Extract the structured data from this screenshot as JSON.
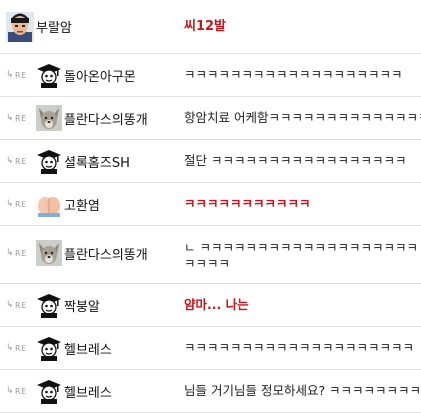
{
  "reply_marker": "RE",
  "post": {
    "author": "부랄암",
    "comment": "씨12발"
  },
  "replies": [
    {
      "author": "돌아온아구몬",
      "avatar": "graduate",
      "comment": "ㅋㅋㅋㅋㅋㅋㅋㅋㅋㅋㅋㅋㅋㅋㅋㅋㅋㅋㅋ",
      "style": "normal"
    },
    {
      "author": "플란다스의똥개",
      "avatar": "dog",
      "comment": "항암치료 어케함ㅋㅋㅋㅋㅋㅋㅋㅋㅋㅋㅋㅋㅋㅋ",
      "style": "normal"
    },
    {
      "author": "셜록홈즈SH",
      "avatar": "graduate",
      "comment": "절단 ㅋㅋㅋㅋㅋㅋㅋㅋㅋㅋㅋㅋㅋㅋㅋㅋㅋ",
      "style": "normal"
    },
    {
      "author": "고환염",
      "avatar": "peach",
      "comment": "ㅋㅋㅋㅋㅋㅋㅋㅋㅋㅋㅋ",
      "style": "red"
    },
    {
      "author": "플란다스의똥개",
      "avatar": "dog",
      "comment": "ㄴ ㅋㅋㅋㅋㅋㅋㅋㅋㅋㅋㅋㅋㅋㅋㅋㅋㅋㅋㅋㅋㅋㅋㅋ",
      "style": "normal",
      "tall": true
    },
    {
      "author": "짝붕알",
      "avatar": "graduate",
      "comment": "얌마... 나는",
      "style": "red"
    },
    {
      "author": "헬브레스",
      "avatar": "graduate",
      "comment": "ㅋㅋㅋㅋㅋㅋㅋㅋㅋㅋㅋㅋㅋㅋㅋㅋㅋㅋㅋㅋ",
      "style": "normal"
    },
    {
      "author": "헬브레스",
      "avatar": "graduate",
      "comment": "님들 거기님들 정모하세요? ㅋㅋㅋㅋㅋㅋㅋㅋ",
      "style": "normal"
    }
  ]
}
